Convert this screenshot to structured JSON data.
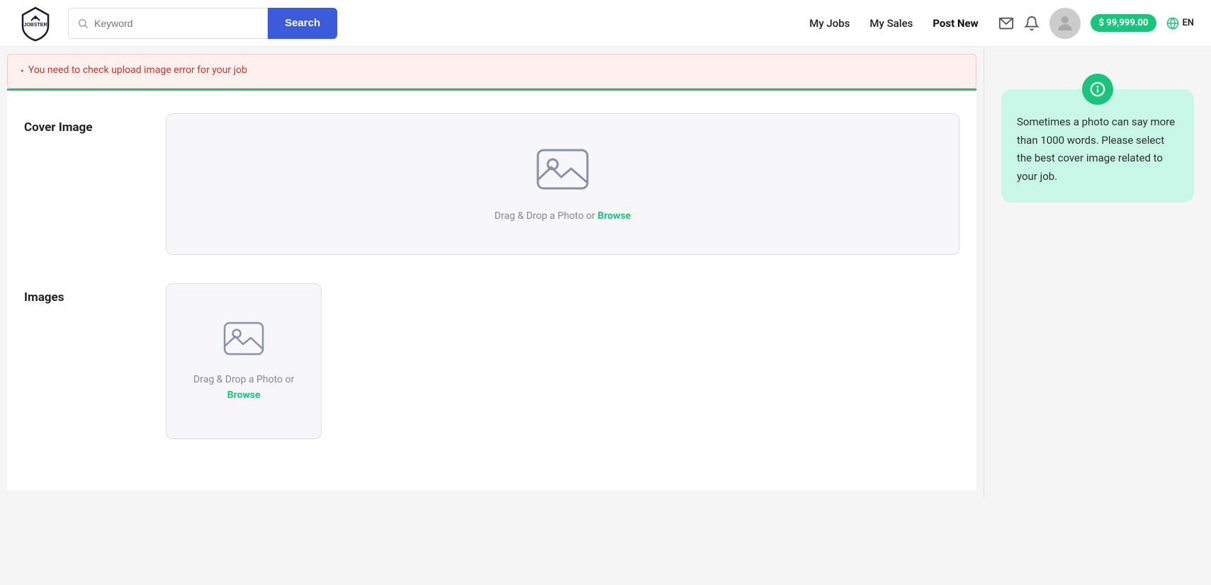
{
  "header": {
    "logo_text": "JOBSTER",
    "search_placeholder": "Keyword",
    "search_button": "Search",
    "nav": {
      "my_jobs": "My Jobs",
      "my_sales": "My Sales",
      "post_new": "Post New"
    },
    "balance": "$ 99,999.00",
    "lang": "EN"
  },
  "error_banner": {
    "items": [
      "You need to check upload image error for your job"
    ]
  },
  "form": {
    "cover_image": {
      "label": "Cover Image",
      "dropzone_text_part1": "Drag & Drop a Photo or ",
      "dropzone_browse": "Browse"
    },
    "images": {
      "label": "Images",
      "dropzone_text_part1": "Drag & Drop a Photo or",
      "dropzone_browse": "Browse"
    }
  },
  "tooltip": {
    "icon": "ℹ",
    "text": "Sometimes a photo can say more than 1000 words. Please select the best cover image related to your job."
  }
}
